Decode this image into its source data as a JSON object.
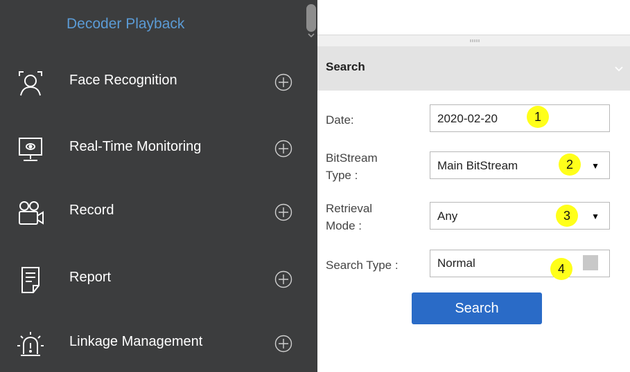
{
  "sidebar": {
    "sub_item": "Decoder Playback",
    "items": [
      {
        "label": "Face Recognition",
        "icon": "face-recognition-icon"
      },
      {
        "label": "Real-Time Monitoring",
        "icon": "monitor-icon"
      },
      {
        "label": "Record",
        "icon": "video-camera-icon"
      },
      {
        "label": "Report",
        "icon": "report-icon"
      },
      {
        "label": "Linkage Management",
        "icon": "alarm-icon"
      }
    ]
  },
  "search_panel": {
    "title": "Search",
    "fields": {
      "date": {
        "label": "Date:",
        "value": "2020-02-20",
        "badge": "1"
      },
      "bitstream": {
        "label_line1": "BitStream",
        "label_line2": "Type :",
        "value": "Main BitStream",
        "badge": "2"
      },
      "retrieval": {
        "label_line1": "Retrieval",
        "label_line2": "Mode :",
        "value": "Any",
        "badge": "3"
      },
      "search_type": {
        "label": "Search Type :",
        "value": "Normal",
        "badge": "4"
      }
    },
    "search_button": "Search"
  },
  "colors": {
    "sidebar_bg": "#3c3d3e",
    "link_blue": "#5b9bd5",
    "button_blue": "#2a6bc7",
    "badge_yellow": "#ffff1a"
  }
}
